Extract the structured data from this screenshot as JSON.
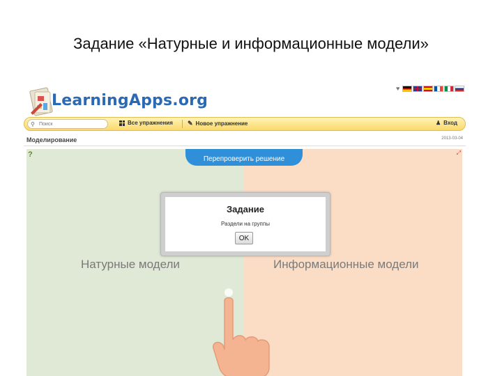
{
  "slide": {
    "title": "Задание «Натурные и информационные модели»"
  },
  "header": {
    "logo_text": "LearningApps.org",
    "search_placeholder": "Поиск",
    "nav": {
      "all_exercises": "Все упражнения",
      "new_exercise": "Новое упражнение",
      "login": "Вход"
    },
    "languages": [
      "de",
      "gb",
      "es",
      "fr",
      "it",
      "ru"
    ]
  },
  "app": {
    "name": "Моделирование",
    "date": "2013-03-04",
    "recheck_label": "Перепроверить решение",
    "groups": [
      "Натурные модели",
      "Информационные модели"
    ],
    "dialog": {
      "title": "Задание",
      "text": "Раздели на группы",
      "ok_label": "OK"
    }
  },
  "colors": {
    "left_bg": "#dfe9d5",
    "right_bg": "#fbddc6",
    "accent_blue": "#2f8fd8",
    "nav_yellow": "#fbd96b",
    "logo_blue": "#2a69b3"
  }
}
